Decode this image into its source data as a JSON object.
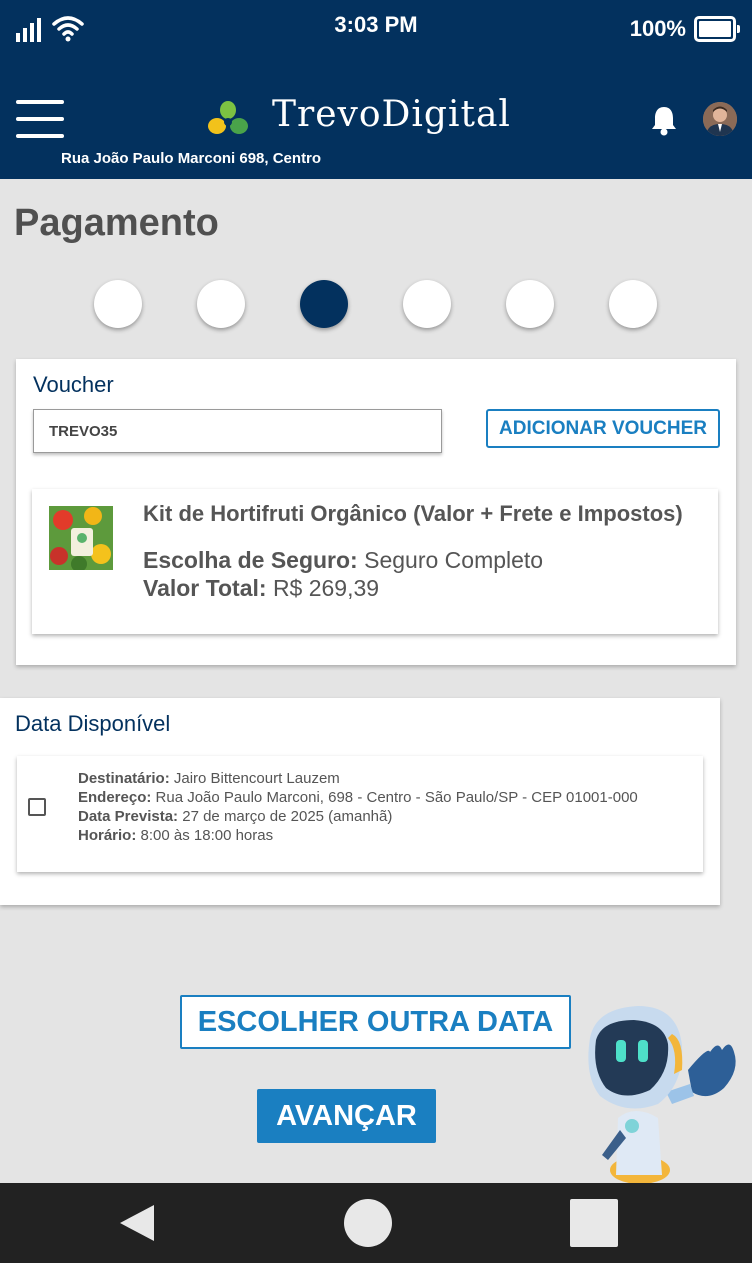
{
  "status_bar": {
    "time": "3:03 PM",
    "battery_text": "100%",
    "battery_level": 1.0,
    "signal_bars": 4
  },
  "app_bar": {
    "brand": "TrevoDigital",
    "address": "Rua João Paulo Marconi 698, Centro"
  },
  "page": {
    "title": "Pagamento"
  },
  "stepper": {
    "total_steps": 6,
    "active_step": 3
  },
  "voucher": {
    "title": "Voucher",
    "input_value": "TREVO35",
    "add_button": "ADICIONAR VOUCHER"
  },
  "product": {
    "name": "Kit de Hortifruti Orgânico (Valor + Frete e Impostos)",
    "insurance_label": "Escolha de Seguro:",
    "insurance_value": "Seguro Completo",
    "total_label": "Valor Total:",
    "total_value": "R$ 269,39"
  },
  "delivery": {
    "title": "Data Disponível",
    "checked": false,
    "recipient_label": "Destinatário:",
    "recipient_value": "Jairo Bittencourt Lauzem",
    "address_label": "Endereço:",
    "address_value": "Rua João Paulo Marconi, 698 - Centro - São Paulo/SP - CEP 01001-000",
    "date_label": "Data Prevista:",
    "date_value": "27 de março de 2025 (amanhã)",
    "time_label": "Horário:",
    "time_value": "8:00 às 18:00 horas"
  },
  "actions": {
    "other_date": "ESCOLHER OUTRA DATA",
    "advance": "AVANÇAR"
  },
  "colors": {
    "primary": "#03315e",
    "accent": "#1a7fc1",
    "background": "#e4e4e4"
  },
  "icons": [
    "signal-icon",
    "wifi-icon",
    "battery-icon",
    "menu-icon",
    "clover-logo-icon",
    "bell-icon",
    "avatar",
    "back-icon",
    "home-icon",
    "recent-apps-icon"
  ]
}
